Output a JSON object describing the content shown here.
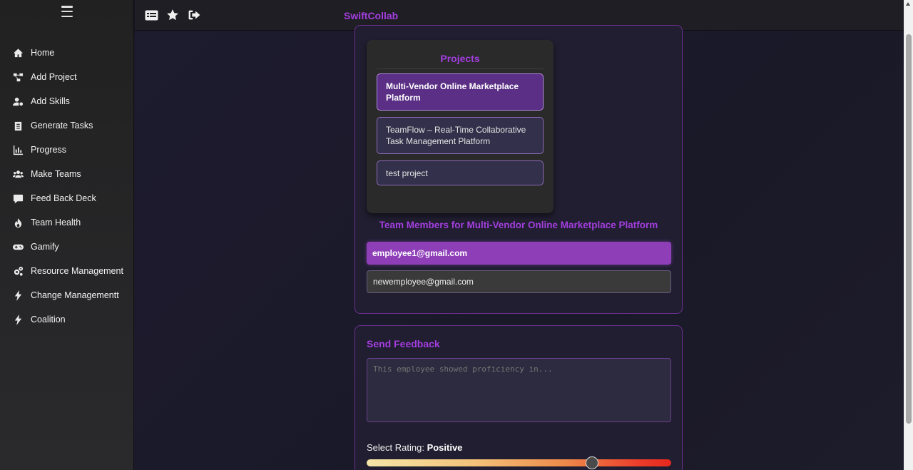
{
  "app": {
    "brand": "SwiftCollab"
  },
  "sidebar": {
    "items": [
      {
        "label": "Home",
        "icon": "home-icon"
      },
      {
        "label": "Add Project",
        "icon": "project-diagram-icon"
      },
      {
        "label": "Add Skills",
        "icon": "user-gear-icon"
      },
      {
        "label": "Generate Tasks",
        "icon": "clipboard-list-icon"
      },
      {
        "label": "Progress",
        "icon": "bar-chart-icon"
      },
      {
        "label": "Make Teams",
        "icon": "users-icon"
      },
      {
        "label": "Feed Back Deck",
        "icon": "comment-icon"
      },
      {
        "label": "Team Health",
        "icon": "fire-icon"
      },
      {
        "label": "Gamify",
        "icon": "gamepad-icon"
      },
      {
        "label": "Resource Management",
        "icon": "cogs-icon"
      },
      {
        "label": "Change Managementt",
        "icon": "bolt-icon"
      },
      {
        "label": "Coalition",
        "icon": "bolt-icon"
      }
    ]
  },
  "topbar": {
    "icons": [
      "list-card-icon",
      "star-icon",
      "sign-out-icon"
    ]
  },
  "projects": {
    "title": "Projects",
    "items": [
      {
        "label": "Multi-Vendor Online Marketplace Platform",
        "active": true
      },
      {
        "label": "TeamFlow – Real-Time Collaborative Task Management Platform",
        "active": false
      },
      {
        "label": "test project",
        "active": false
      }
    ]
  },
  "members": {
    "title": "Team Members for Multi-Vendor Online Marketplace Platform",
    "items": [
      {
        "email": "employee1@gmail.com",
        "active": true
      },
      {
        "email": "newemployee@gmail.com",
        "active": false
      }
    ]
  },
  "feedback": {
    "title": "Send Feedback",
    "placeholder": "This employee showed proficiency in...",
    "rating_prefix": "Select Rating:",
    "rating_value": "Positive",
    "rating_level": 0.74
  },
  "colors": {
    "accent": "#a43ee0",
    "active_project": "#5a2f85",
    "active_member": "#8e3fb8"
  }
}
